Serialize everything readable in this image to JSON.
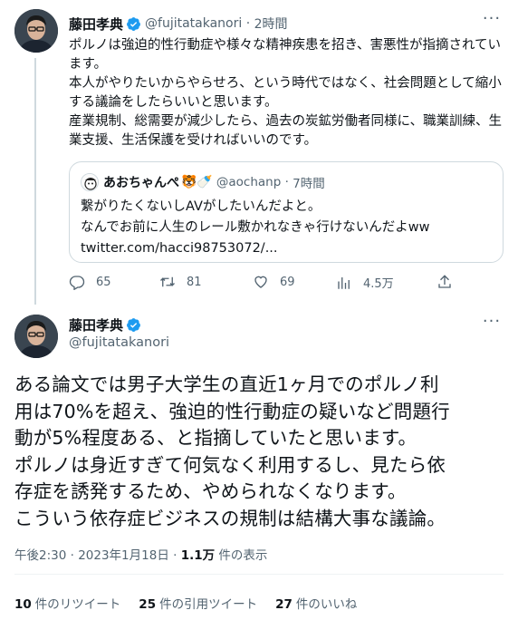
{
  "colors": {
    "verified": "#1d9bf0",
    "secondary_text": "#536471",
    "border": "#cfd9de"
  },
  "tweet1": {
    "author_name": "藤田孝典",
    "author_handle": "@fujitatakanori",
    "time": "2時間",
    "more_label": "···",
    "body": [
      "ポルノは強迫的性行動症や様々な精神疾患を招き、害悪性が指摘されています。",
      "本人がやりたいからやらせろ、という時代ではなく、社会問題として縮小する議論をしたらいいと思います。",
      "産業規制、総需要が減少したら、過去の炭鉱労働者同様に、職業訓練、生業支援、生活保護を受ければいいのです。"
    ],
    "quote": {
      "author_name": "あおちゃんぺ",
      "emojis": "🐯🍼",
      "author_handle": "@aochanp",
      "time": "7時間",
      "lines": [
        "繋がりたくないしAVがしたいんだよと。",
        "なんでお前に人生のレール敷かれなきゃ行けないんだよww",
        "twitter.com/hacci98753072/..."
      ]
    },
    "actions": {
      "replies": "65",
      "retweets": "81",
      "likes": "69",
      "views": "4.5万"
    }
  },
  "tweet2": {
    "author_name": "藤田孝典",
    "author_handle": "@fujitatakanori",
    "more_label": "···",
    "body": [
      "ある論文では男子大学生の直近1ヶ月でのポルノ利",
      "用は70%を超え、強迫的性行動症の疑いなど問題行",
      "動が5%程度ある、と指摘していたと思います。",
      "ポルノは身近すぎて何気なく利用するし、見たら依",
      "存症を誘発するため、やめられなくなります。",
      "こういう依存症ビジネスの規制は結構大事な議論。"
    ],
    "timestamp": "午後2:30 · 2023年1月18日 · ",
    "views_count": "1.1万",
    "views_label": " 件の表示",
    "stats": [
      {
        "count": "10",
        "label": "件のリツイート"
      },
      {
        "count": "25",
        "label": "件の引用ツイート"
      },
      {
        "count": "27",
        "label": "件のいいね"
      }
    ]
  }
}
